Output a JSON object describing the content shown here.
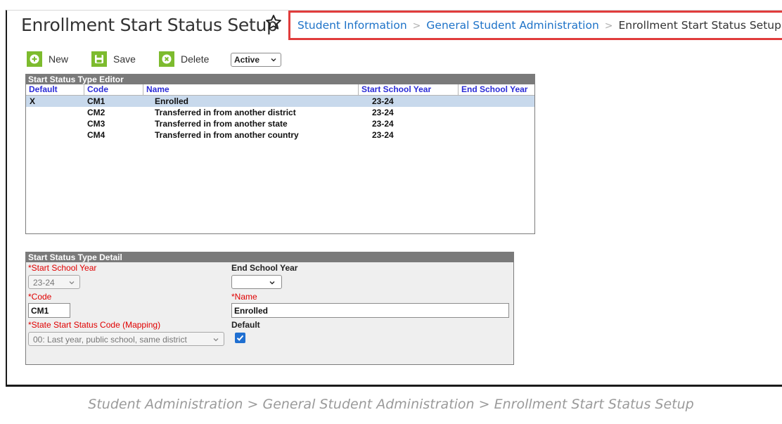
{
  "header": {
    "title": "Enrollment Start Status Setup",
    "breadcrumb": [
      "Student Information",
      "General Student Administration",
      "Enrollment Start Status Setup"
    ]
  },
  "toolbar": {
    "new_label": "New",
    "save_label": "Save",
    "delete_label": "Delete",
    "status_filter": "Active",
    "accent": "#7dbb2e"
  },
  "editor": {
    "title": "Start Status Type Editor",
    "columns": [
      "Default",
      "Code",
      "Name",
      "Start School Year",
      "End School Year"
    ],
    "rows": [
      {
        "default": "X",
        "code": "CM1",
        "name": "Enrolled",
        "start": "23-24",
        "end": ""
      },
      {
        "default": "",
        "code": "CM2",
        "name": "Transferred in from another district",
        "start": "23-24",
        "end": ""
      },
      {
        "default": "",
        "code": "CM3",
        "name": "Transferred in from another state",
        "start": "23-24",
        "end": ""
      },
      {
        "default": "",
        "code": "CM4",
        "name": "Transferred in from another country",
        "start": "23-24",
        "end": ""
      }
    ]
  },
  "detail": {
    "title": "Start Status Type Detail",
    "start_year_label": "*Start School Year",
    "start_year_value": "23-24",
    "end_year_label": "End School Year",
    "end_year_value": "",
    "code_label": "*Code",
    "code_value": "CM1",
    "name_label": "*Name",
    "name_value": "Enrolled",
    "state_code_label": "*State Start Status Code (Mapping)",
    "state_code_value": "00: Last year, public school, same district",
    "default_label": "Default",
    "default_checked": true
  },
  "caption": "Student Administration > General Student Administration > Enrollment Start Status Setup",
  "colors": {
    "link": "#1d72c8",
    "highlight_border": "#e03c3c",
    "required": "#e00000",
    "selected_row": "#c8d9ec"
  }
}
